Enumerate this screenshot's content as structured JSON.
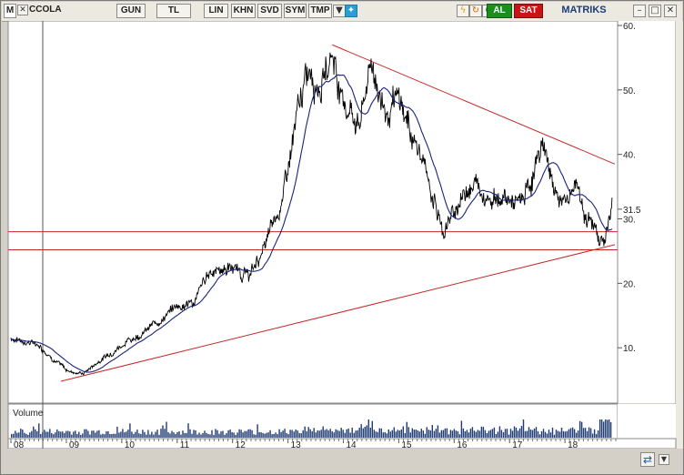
{
  "toolbar": {
    "app_logo": "M",
    "symbol": "CCOLA",
    "period": "GUN",
    "currency": "TL",
    "scale": "LIN",
    "btn_khn": "KHN",
    "btn_svd": "SVD",
    "btn_sym": "SYM",
    "btn_tmp": "TMP",
    "buy": "AL",
    "sell": "SAT",
    "brand": "MATRIKS",
    "icons": [
      "checkbox-icon",
      "dropdown-arrow-icon",
      "twitter-bird-icon",
      "lightning-icon",
      "refresh-icon",
      "copyright-c-icon",
      "minimize-icon",
      "restore-icon",
      "close-icon"
    ]
  },
  "chart": {
    "volume_label": "Volume",
    "price_axis_ticks": [
      "60.",
      "50.",
      "40.",
      "31.5",
      "30.",
      "20.",
      "10."
    ],
    "x_axis_labels": [
      "08",
      "09",
      "10",
      "11",
      "12",
      "13",
      "14",
      "15",
      "16",
      "17",
      "18"
    ],
    "colors": {
      "price": "#000000",
      "moving_average": "#1a237e",
      "trendline": "#c62828",
      "volume": "#1f3b73",
      "background": "#ffffff"
    }
  },
  "chart_data": {
    "type": "line",
    "x": [
      "08",
      "09",
      "10",
      "11",
      "12",
      "13",
      "14",
      "15",
      "16",
      "17",
      "18"
    ],
    "ylim": [
      0,
      60
    ],
    "approx_price_path": [
      [
        "2008.0",
        11.5
      ],
      [
        "2008.5",
        10.5
      ],
      [
        "2009.0",
        6.5
      ],
      [
        "2009.3",
        6.0
      ],
      [
        "2009.6",
        8.0
      ],
      [
        "2010.0",
        10.5
      ],
      [
        "2010.5",
        13.0
      ],
      [
        "2011.0",
        16.5
      ],
      [
        "2011.3",
        17.0
      ],
      [
        "2011.6",
        22.0
      ],
      [
        "2012.0",
        22.5
      ],
      [
        "2012.3",
        21.0
      ],
      [
        "2012.6",
        26.0
      ],
      [
        "2012.9",
        33.0
      ],
      [
        "2013.2",
        47.0
      ],
      [
        "2013.4",
        54.0
      ],
      [
        "2013.6",
        51.0
      ],
      [
        "2013.8",
        56.0
      ],
      [
        "2014.0",
        48.0
      ],
      [
        "2014.3",
        45.0
      ],
      [
        "2014.5",
        54.0
      ],
      [
        "2014.8",
        46.0
      ],
      [
        "2015.0",
        48.0
      ],
      [
        "2015.3",
        42.0
      ],
      [
        "2015.6",
        34.0
      ],
      [
        "2015.8",
        28.0
      ],
      [
        "2016.0",
        31.0
      ],
      [
        "2016.3",
        36.0
      ],
      [
        "2016.6",
        34.0
      ],
      [
        "2016.9",
        33.0
      ],
      [
        "2017.2",
        32.0
      ],
      [
        "2017.4",
        36.0
      ],
      [
        "2017.6",
        42.0
      ],
      [
        "2017.8",
        35.0
      ],
      [
        "2018.0",
        32.0
      ],
      [
        "2018.2",
        36.0
      ],
      [
        "2018.4",
        30.0
      ],
      [
        "2018.55",
        28.0
      ],
      [
        "2018.7",
        26.5
      ],
      [
        "2018.85",
        31.5
      ]
    ],
    "horizontal_lines": [
      28.0,
      25.2
    ],
    "trendlines": [
      {
        "from": [
          "2013.8",
          57.0
        ],
        "to": [
          "2018.9",
          38.5
        ]
      },
      {
        "from": [
          "2008.9",
          4.8
        ],
        "to": [
          "2018.9",
          26.0
        ]
      }
    ]
  },
  "statusbar": {
    "sync_icon": "sync-arrows-icon",
    "dropdown_icon": "dropdown-arrow-icon"
  }
}
